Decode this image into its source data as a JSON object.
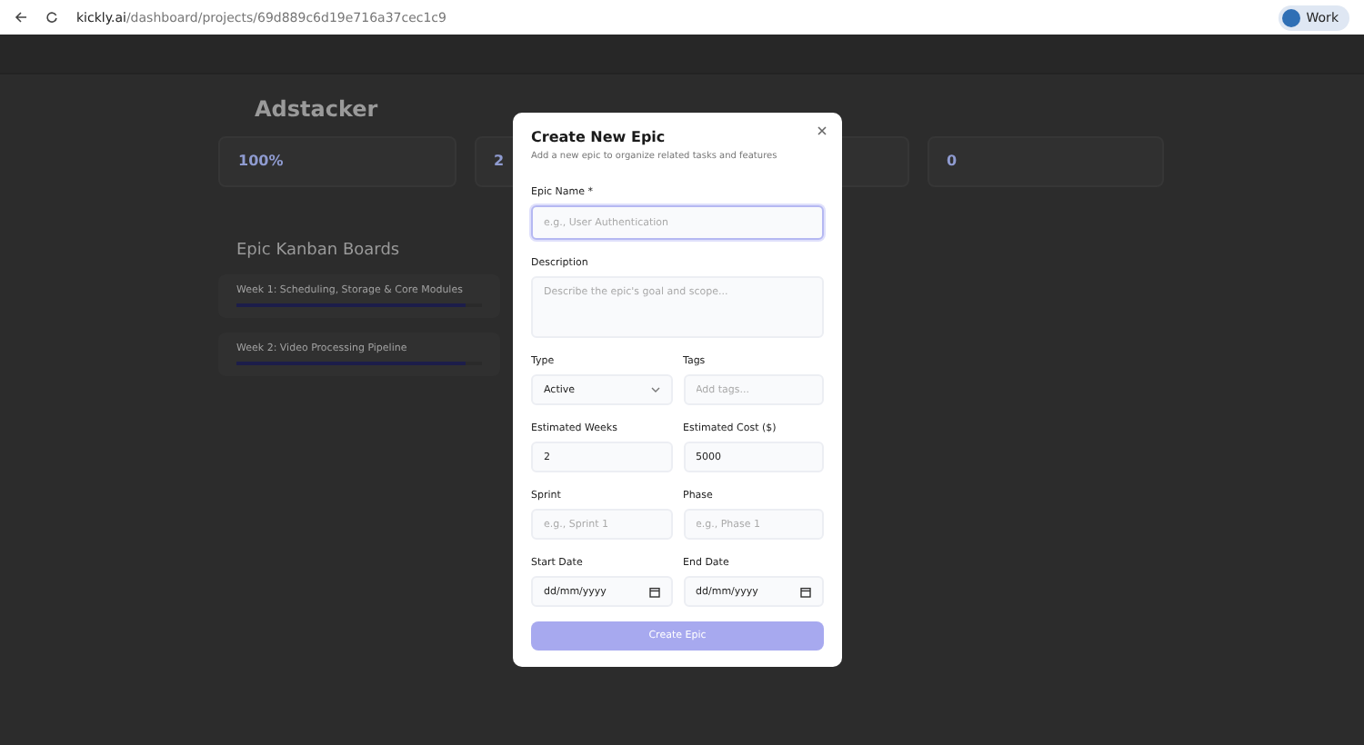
{
  "browser": {
    "url_host": "kickly.ai",
    "url_path": "/dashboard/projects/69d889c6d19e716a37cec1c9",
    "profile": "Work"
  },
  "project": {
    "title": "Adstacker"
  },
  "stats": [
    {
      "value": "100%"
    },
    {
      "value": "2"
    },
    {
      "value": "0"
    }
  ],
  "board": {
    "title": "Epic Kanban Boards",
    "cards": [
      {
        "title": "Week 1: Scheduling, Storage & Core Modules",
        "level": 0.93
      },
      {
        "title": "Week 2: Video Processing Pipeline",
        "level": 0.93
      }
    ]
  },
  "modal": {
    "title": "Create New Epic",
    "subtitle": "Add a new epic to organize related tasks and features",
    "rows": [
      [
        {
          "label": "Epic Name *",
          "kind": "text",
          "placeholder": "e.g., User Authentication",
          "focused": true
        }
      ],
      [
        {
          "label": "Description",
          "kind": "textarea",
          "placeholder": "Describe the epic's goal and scope...",
          "focused": false
        }
      ],
      [
        {
          "label": "Type",
          "kind": "select",
          "value": "Active",
          "focused": false
        },
        {
          "label": "Tags",
          "kind": "text",
          "placeholder": "Add tags...",
          "focused": false
        }
      ],
      [
        {
          "label": "Estimated Weeks",
          "kind": "text",
          "value": "2",
          "focused": false
        },
        {
          "label": "Estimated Cost ($)",
          "kind": "text",
          "value": "5000",
          "focused": false
        }
      ],
      [
        {
          "label": "Sprint",
          "kind": "text",
          "placeholder": "e.g., Sprint 1",
          "focused": false
        },
        {
          "label": "Phase",
          "kind": "text",
          "placeholder": "e.g., Phase 1",
          "focused": false
        }
      ],
      [
        {
          "label": "Start Date",
          "kind": "date",
          "value": "dd/mm/yyyy",
          "focused": false
        },
        {
          "label": "End Date",
          "kind": "date",
          "value": "dd/mm/yyyy",
          "focused": false
        }
      ]
    ],
    "submit": {
      "label": "Create Epic",
      "disabled": true
    }
  }
}
